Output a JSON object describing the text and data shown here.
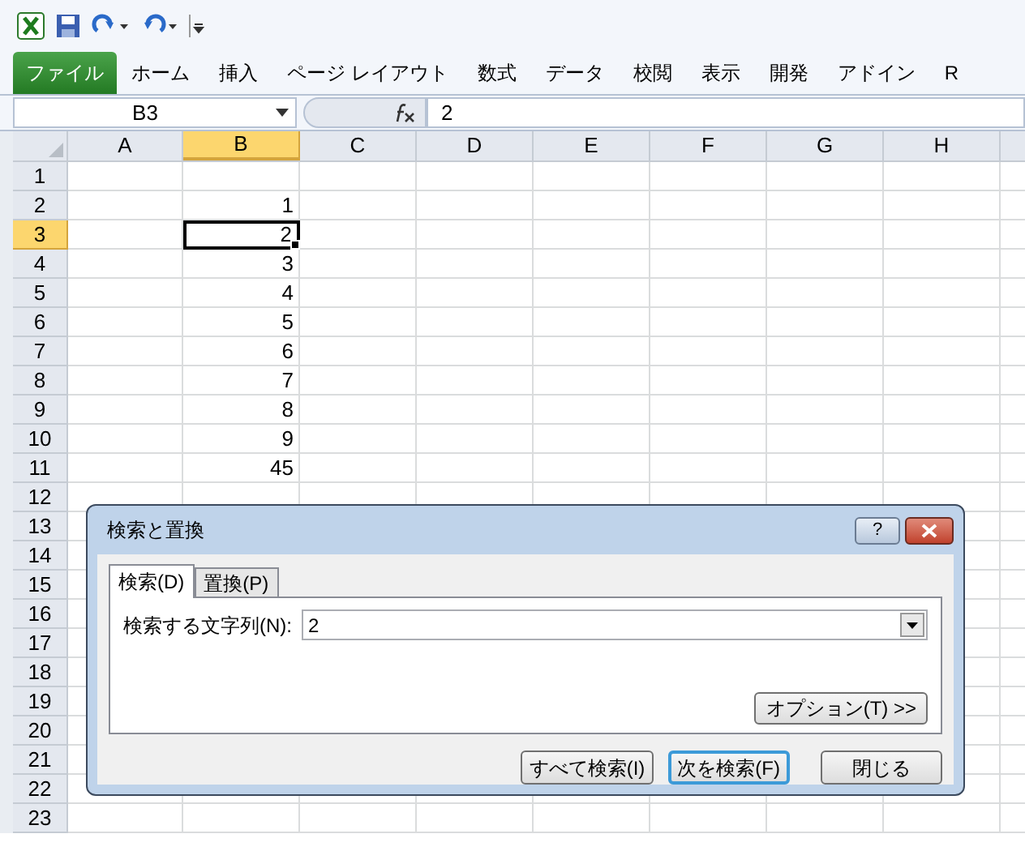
{
  "ribbon": {
    "file_tab": "ファイル",
    "tabs": [
      "ホーム",
      "挿入",
      "ページ レイアウト",
      "数式",
      "データ",
      "校閲",
      "表示",
      "開発",
      "アドイン",
      "R"
    ]
  },
  "formula_bar": {
    "name_box": "B3",
    "formula": "2"
  },
  "columns": [
    {
      "label": "A",
      "selected": false
    },
    {
      "label": "B",
      "selected": true
    },
    {
      "label": "C",
      "selected": false
    },
    {
      "label": "D",
      "selected": false
    },
    {
      "label": "E",
      "selected": false
    },
    {
      "label": "F",
      "selected": false
    },
    {
      "label": "G",
      "selected": false
    },
    {
      "label": "H",
      "selected": false
    }
  ],
  "rows": [
    {
      "label": "1",
      "selected": false
    },
    {
      "label": "2",
      "selected": false,
      "value": "1"
    },
    {
      "label": "3",
      "selected": true,
      "value": "2"
    },
    {
      "label": "4",
      "selected": false,
      "value": "3"
    },
    {
      "label": "5",
      "selected": false,
      "value": "4"
    },
    {
      "label": "6",
      "selected": false,
      "value": "5"
    },
    {
      "label": "7",
      "selected": false,
      "value": "6"
    },
    {
      "label": "8",
      "selected": false,
      "value": "7"
    },
    {
      "label": "9",
      "selected": false,
      "value": "8"
    },
    {
      "label": "10",
      "selected": false,
      "value": "9"
    },
    {
      "label": "11",
      "selected": false,
      "value": "45"
    },
    {
      "label": "12",
      "selected": false
    },
    {
      "label": "13",
      "selected": false
    },
    {
      "label": "14",
      "selected": false
    },
    {
      "label": "15",
      "selected": false
    },
    {
      "label": "16",
      "selected": false
    },
    {
      "label": "17",
      "selected": false
    },
    {
      "label": "18",
      "selected": false
    },
    {
      "label": "19",
      "selected": false
    },
    {
      "label": "20",
      "selected": false
    },
    {
      "label": "21",
      "selected": false
    },
    {
      "label": "22",
      "selected": false
    },
    {
      "label": "23",
      "selected": false
    }
  ],
  "dialog": {
    "title": "検索と置換",
    "help": "?",
    "tabs": [
      {
        "label": "検索(D)",
        "selected": true
      },
      {
        "label": "置換(P)",
        "selected": false
      }
    ],
    "search_label": "検索する文字列(N):",
    "search_value": "2",
    "options_button": "オプション(T) >>",
    "buttons": [
      {
        "label": "すべて検索(I)",
        "default": false
      },
      {
        "label": "次を検索(F)",
        "default": true
      },
      {
        "label": "閉じる",
        "default": false
      }
    ]
  }
}
